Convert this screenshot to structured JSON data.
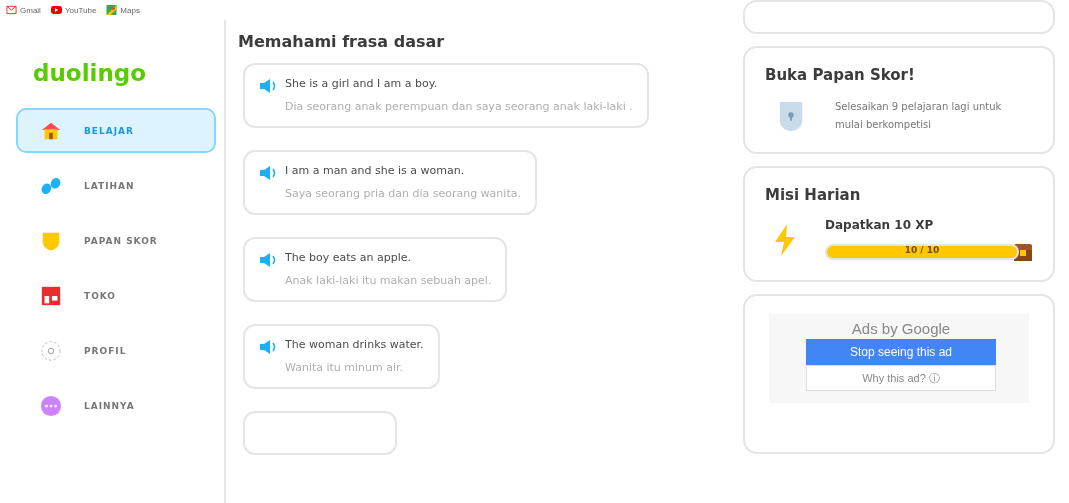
{
  "bookmarks": [
    {
      "label": "Gmail"
    },
    {
      "label": "YouTube"
    },
    {
      "label": "Maps"
    }
  ],
  "sidebar": {
    "logo": "duolingo",
    "items": [
      {
        "label": "BELAJAR",
        "selected": true
      },
      {
        "label": "LATIHAN",
        "selected": false
      },
      {
        "label": "PAPAN SKOR",
        "selected": false
      },
      {
        "label": "TOKO",
        "selected": false
      },
      {
        "label": "PROFIL",
        "selected": false
      },
      {
        "label": "LAINNYA",
        "selected": false
      }
    ]
  },
  "main": {
    "title": "Memahami frasa dasar",
    "phrases": [
      {
        "text": "She is a girl and I am a boy.",
        "translation": "Dia seorang anak perempuan dan saya seorang anak laki-laki ."
      },
      {
        "text": "I am a man and she is a woman.",
        "translation": "Saya seorang pria dan dia seorang wanita."
      },
      {
        "text": "The boy eats an apple.",
        "translation": "Anak laki-laki itu makan sebuah apel."
      },
      {
        "text": "The woman drinks water.",
        "translation": "Wanita itu minum air."
      }
    ]
  },
  "leaderboard": {
    "title": "Buka Papan Skor!",
    "text": "Selesaikan 9 pelajaran lagi untuk mulai berkompetisi"
  },
  "quests": {
    "title": "Misi Harian",
    "task": "Dapatkan 10 XP",
    "level": 1,
    "reading": "10 / 10"
  },
  "ad": {
    "label": "Ads by Google",
    "stop_button": "Stop seeing this ad",
    "why_button": "Why this ad? ⓘ"
  }
}
